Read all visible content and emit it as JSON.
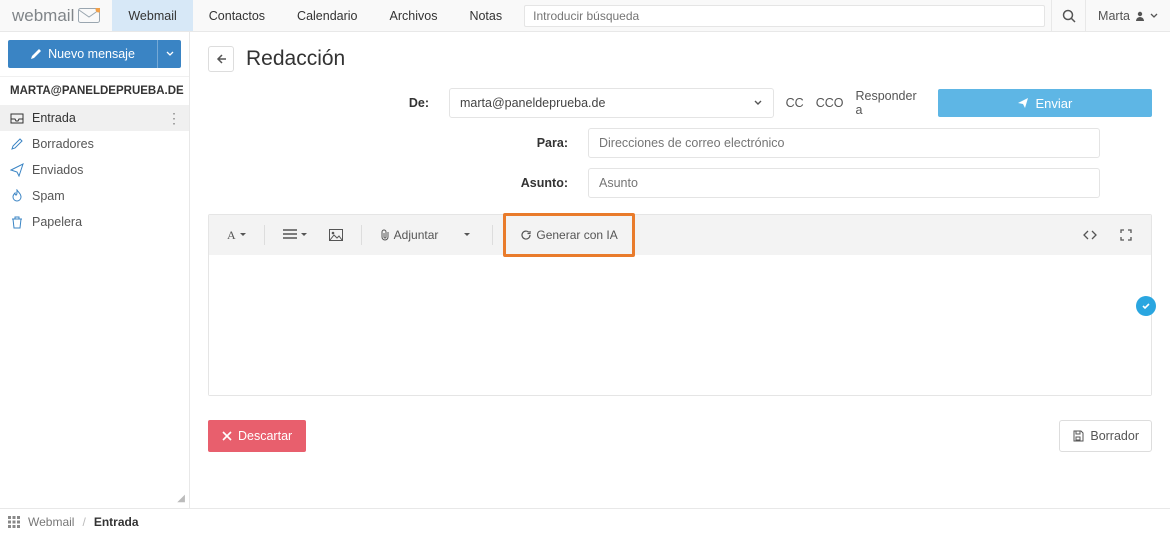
{
  "brand": {
    "name": "webmail"
  },
  "nav": {
    "tabs": [
      "Webmail",
      "Contactos",
      "Calendario",
      "Archivos",
      "Notas"
    ],
    "active_index": 0
  },
  "search": {
    "placeholder": "Introducir búsqueda"
  },
  "user": {
    "name": "Marta"
  },
  "sidebar": {
    "compose_label": "Nuevo mensaje",
    "account": "MARTA@PANELDEPRUEBA.DE",
    "folders": [
      {
        "label": "Entrada",
        "icon": "inbox"
      },
      {
        "label": "Borradores",
        "icon": "pencil"
      },
      {
        "label": "Enviados",
        "icon": "plane"
      },
      {
        "label": "Spam",
        "icon": "flame"
      },
      {
        "label": "Papelera",
        "icon": "trash"
      }
    ],
    "active_folder_index": 0
  },
  "compose": {
    "title": "Redacción",
    "labels": {
      "from": "De:",
      "to": "Para:",
      "subject": "Asunto:"
    },
    "from_value": "marta@paneldeprueba.de",
    "to_placeholder": "Direcciones de correo electrónico",
    "subject_placeholder": "Asunto",
    "cc": "CC",
    "cco": "CCO",
    "reply_to": "Responder a",
    "send": "Enviar",
    "toolbar": {
      "attach": "Adjuntar",
      "ai": "Generar con IA"
    },
    "discard": "Descartar",
    "draft": "Borrador"
  },
  "breadcrumb": {
    "app": "Webmail",
    "current": "Entrada"
  },
  "colors": {
    "primary": "#3a84c4",
    "accent": "#5eb6e5",
    "danger": "#e85f6d",
    "highlight": "#e97b2b"
  }
}
